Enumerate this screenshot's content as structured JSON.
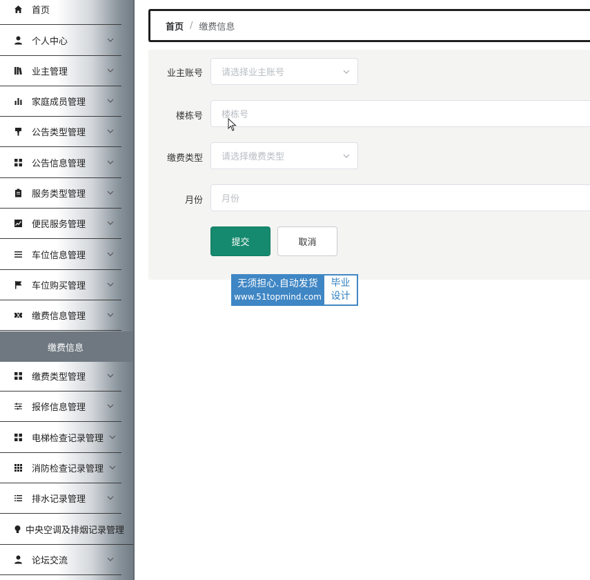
{
  "sidebar": {
    "items": [
      {
        "label": "首页",
        "icon": "home-icon"
      },
      {
        "label": "个人中心",
        "icon": "user-icon"
      },
      {
        "label": "业主管理",
        "icon": "library-icon"
      },
      {
        "label": "家庭成员管理",
        "icon": "bar-chart-icon"
      },
      {
        "label": "公告类型管理",
        "icon": "paint-roller-icon"
      },
      {
        "label": "公告信息管理",
        "icon": "grid-icon"
      },
      {
        "label": "服务类型管理",
        "icon": "clipboard-icon"
      },
      {
        "label": "便民服务管理",
        "icon": "trend-chart-icon"
      },
      {
        "label": "车位信息管理",
        "icon": "list-icon"
      },
      {
        "label": "车位购买管理",
        "icon": "flag-icon"
      },
      {
        "label": "缴费信息管理",
        "icon": "ticket-icon"
      },
      {
        "label": "缴费类型管理",
        "icon": "grid-icon"
      },
      {
        "label": "报修信息管理",
        "icon": "sliders-icon"
      },
      {
        "label": "电梯检查记录管理",
        "icon": "grid-icon"
      },
      {
        "label": "消防检查记录管理",
        "icon": "dots-grid-icon"
      },
      {
        "label": "排水记录管理",
        "icon": "list-icon"
      },
      {
        "label": "中央空调及排烟记录管理",
        "icon": "bulb-icon"
      },
      {
        "label": "论坛交流",
        "icon": "user-icon"
      }
    ],
    "active_sub": "缴费信息"
  },
  "breadcrumb": {
    "home": "首页",
    "separator": "/",
    "current": "缴费信息"
  },
  "form": {
    "owner_account": {
      "label": "业主账号",
      "placeholder": "请选择业主账号"
    },
    "building": {
      "label": "楼栋号",
      "placeholder": "楼栋号"
    },
    "fee_type": {
      "label": "缴费类型",
      "placeholder": "请选择缴费类型"
    },
    "month": {
      "label": "月份",
      "placeholder": "月份"
    },
    "submit": "提交",
    "cancel": "取消"
  },
  "watermark": {
    "line1": "无须担心.自动发货",
    "line2": "www.51topmind.com",
    "right1": "毕业",
    "right2": "设计"
  },
  "colors": {
    "primary": "#168a6e",
    "active_sub_bg": "#6f7880",
    "panel_bg": "#f4f4f3",
    "watermark_bg": "#3f86c4"
  }
}
